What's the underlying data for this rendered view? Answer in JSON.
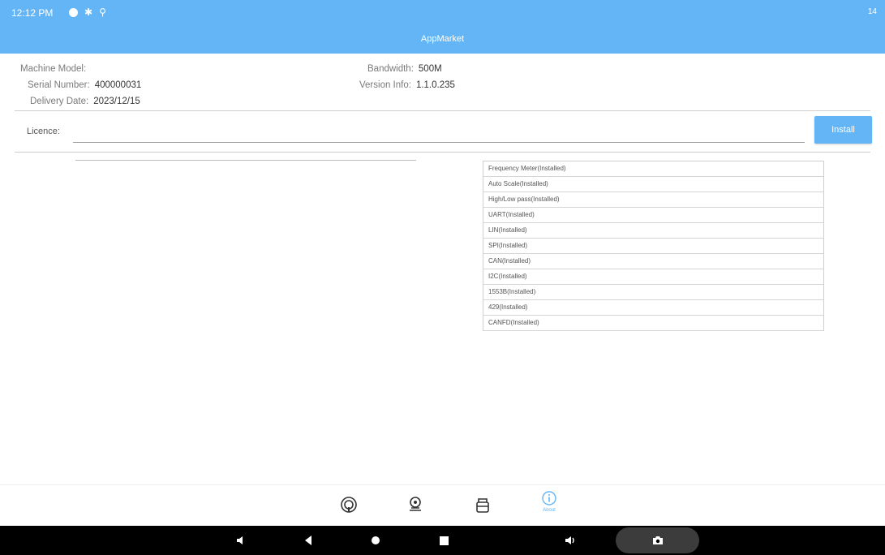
{
  "status_bar": {
    "time": "12:12 PM",
    "right_text": "14"
  },
  "header": {
    "title": "AppMarket"
  },
  "device_info": {
    "machine_model_label": "Machine Model:",
    "machine_model_value": "",
    "serial_number_label": "Serial Number:",
    "serial_number_value": "400000031",
    "delivery_date_label": "Delivery Date:",
    "delivery_date_value": "2023/12/15",
    "bandwidth_label": "Bandwidth:",
    "bandwidth_value": "500M",
    "version_info_label": "Version Info:",
    "version_info_value": "1.1.0.235"
  },
  "licence": {
    "label": "Licence:",
    "value": "",
    "install_label": "Install"
  },
  "features": [
    "Frequency Meter(Installed)",
    "Auto Scale(Installed)",
    "High/Low pass(Installed)",
    "UART(Installed)",
    "LIN(Installed)",
    "SPI(Installed)",
    "CAN(Installed)",
    "I2C(Installed)",
    "1553B(Installed)",
    "429(Installed)",
    "CANFD(Installed)"
  ],
  "bottom_nav": {
    "about_label": "About"
  },
  "colors": {
    "accent": "#64b5f6",
    "system_bar": "#000000"
  },
  "icons": [
    "circle-target-icon",
    "location-pin-icon",
    "package-icon",
    "info-icon",
    "volume-down-icon",
    "back-icon",
    "home-icon",
    "recents-icon",
    "volume-up-icon",
    "camera-icon"
  ]
}
